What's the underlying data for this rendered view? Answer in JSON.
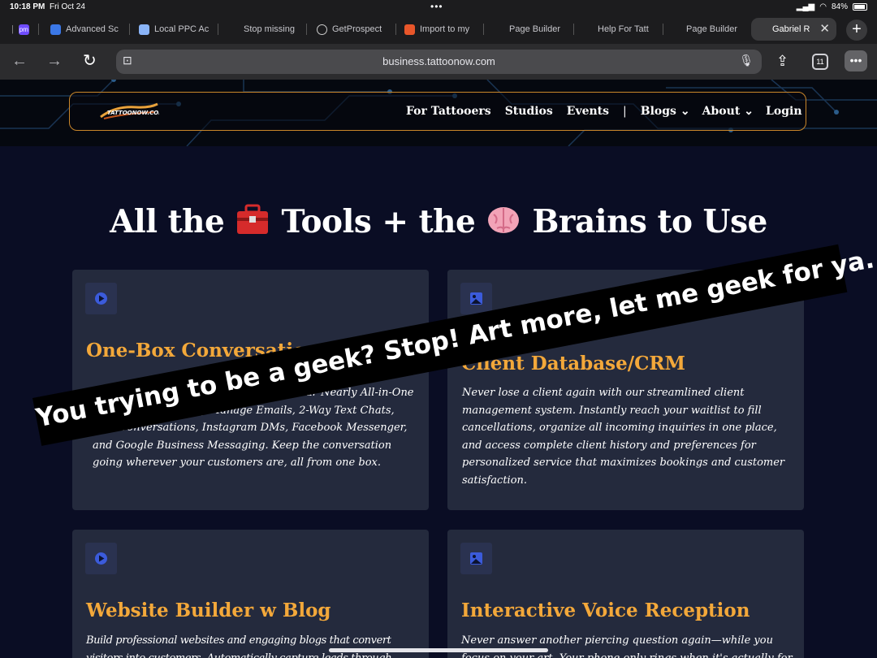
{
  "status": {
    "time": "10:18 PM",
    "date": "Fri Oct 24",
    "battery": "84%"
  },
  "tabs": [
    {
      "label": "",
      "favicon_color": "#6f4cff",
      "favicon_text": "pm"
    },
    {
      "label": "Advanced Sc",
      "favicon_color": "#3b78e7",
      "favicon_text": ""
    },
    {
      "label": "Local PPC Ac",
      "favicon_color": "#8ab4f8",
      "favicon_text": ""
    },
    {
      "label": "Stop missing",
      "favicon_color": "",
      "favicon_text": ""
    },
    {
      "label": "GetProspect",
      "favicon_color": "#aaaaaa",
      "favicon_text": ""
    },
    {
      "label": "Import to my",
      "favicon_color": "#e8562a",
      "favicon_text": ""
    },
    {
      "label": "Page Builder",
      "favicon_color": "",
      "favicon_text": ""
    },
    {
      "label": "Help For Tatt",
      "favicon_color": "",
      "favicon_text": ""
    },
    {
      "label": "Page Builder",
      "favicon_color": "",
      "favicon_text": ""
    },
    {
      "label": "Gabriel R",
      "favicon_color": "",
      "favicon_text": ""
    }
  ],
  "toolbar": {
    "url": "business.tattoonow.com",
    "tab_count": "11"
  },
  "site": {
    "logo_text": "TATTOONOW.COM",
    "nav": [
      "For Tattooers",
      "Studios",
      "Events",
      "|",
      "Blogs",
      "About",
      "Login"
    ]
  },
  "hero": {
    "part1": "All the ",
    "part2": " Tools + the ",
    "part3": " Brains to Use"
  },
  "cards": [
    {
      "title": "One-Box Conversations",
      "text": "Streamline Your Communication with Our Nearly All-in-One Platform! Seamlessly Manage Emails, 2-Way Text Chats, Web Conversations, Instagram DMs, Facebook Messenger, and Google Business Messaging. Keep the conversation going wherever your customers are, all from one box."
    },
    {
      "title": "Client Database/CRM",
      "text": "Never lose a client again with our streamlined client management system. Instantly reach your waitlist to fill cancellations, organize all incoming inquiries in one place, and access complete client history and preferences for personalized service that maximizes bookings and customer satisfaction."
    },
    {
      "title": "Website Builder w Blog",
      "text": "Build professional websites and engaging blogs that convert visitors into customers. Automatically capture leads through integrated forms and landing pages."
    },
    {
      "title": "Interactive Voice Reception",
      "text": "Never answer another piercing question again—while you focus on your art. Your phone only rings when it's actually for you, with."
    }
  ],
  "sticker": {
    "text": "You trying to be a geek? Stop! Art more, let me geek for ya."
  }
}
